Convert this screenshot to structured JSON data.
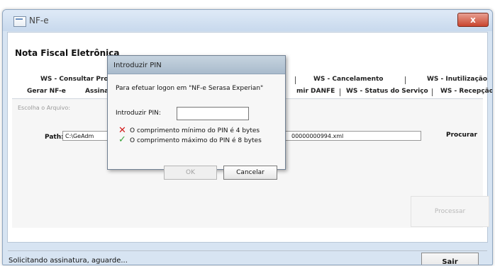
{
  "window": {
    "title": "NF-e",
    "close_label": "x"
  },
  "header": {
    "heading": "Nota Fiscal Eletrônica"
  },
  "tabs": {
    "row1": [
      "WS - Consultar Proc",
      "WS - Cancelamento",
      "WS - Inutilização"
    ],
    "row2": [
      "Gerar NF-e",
      "Assinar",
      "mir DANFE",
      "WS - Status do Serviço",
      "WS - Recepção"
    ]
  },
  "panel": {
    "hint": "Escolha o Arquivo:",
    "path_label": "Path:",
    "path_left": "C:\\GeAdm",
    "path_right": "00000000994.xml",
    "browse_label": "Procurar",
    "process_label": "Processar"
  },
  "status": {
    "text": "Solicitando assinatura, aguarde...",
    "exit_label": "Sair"
  },
  "dialog": {
    "title": "Introduzir PIN",
    "message": "Para efetuar logon em \"NF-e Serasa Experian\"",
    "pin_label": "Introduzir PIN:",
    "pin_value": "",
    "rules": [
      {
        "status": "fail",
        "icon": "red-x-icon",
        "text": "O comprimento mínimo do PIN é 4 bytes"
      },
      {
        "status": "pass",
        "icon": "green-check-icon",
        "text": "O comprimento máximo do PIN é 8 bytes"
      }
    ],
    "ok_label": "OK",
    "cancel_label": "Cancelar"
  },
  "colors": {
    "window_frame": "#d7e4f2",
    "close_button": "#c9452f",
    "fail_icon": "#d11a1a",
    "pass_icon": "#39a33a"
  }
}
